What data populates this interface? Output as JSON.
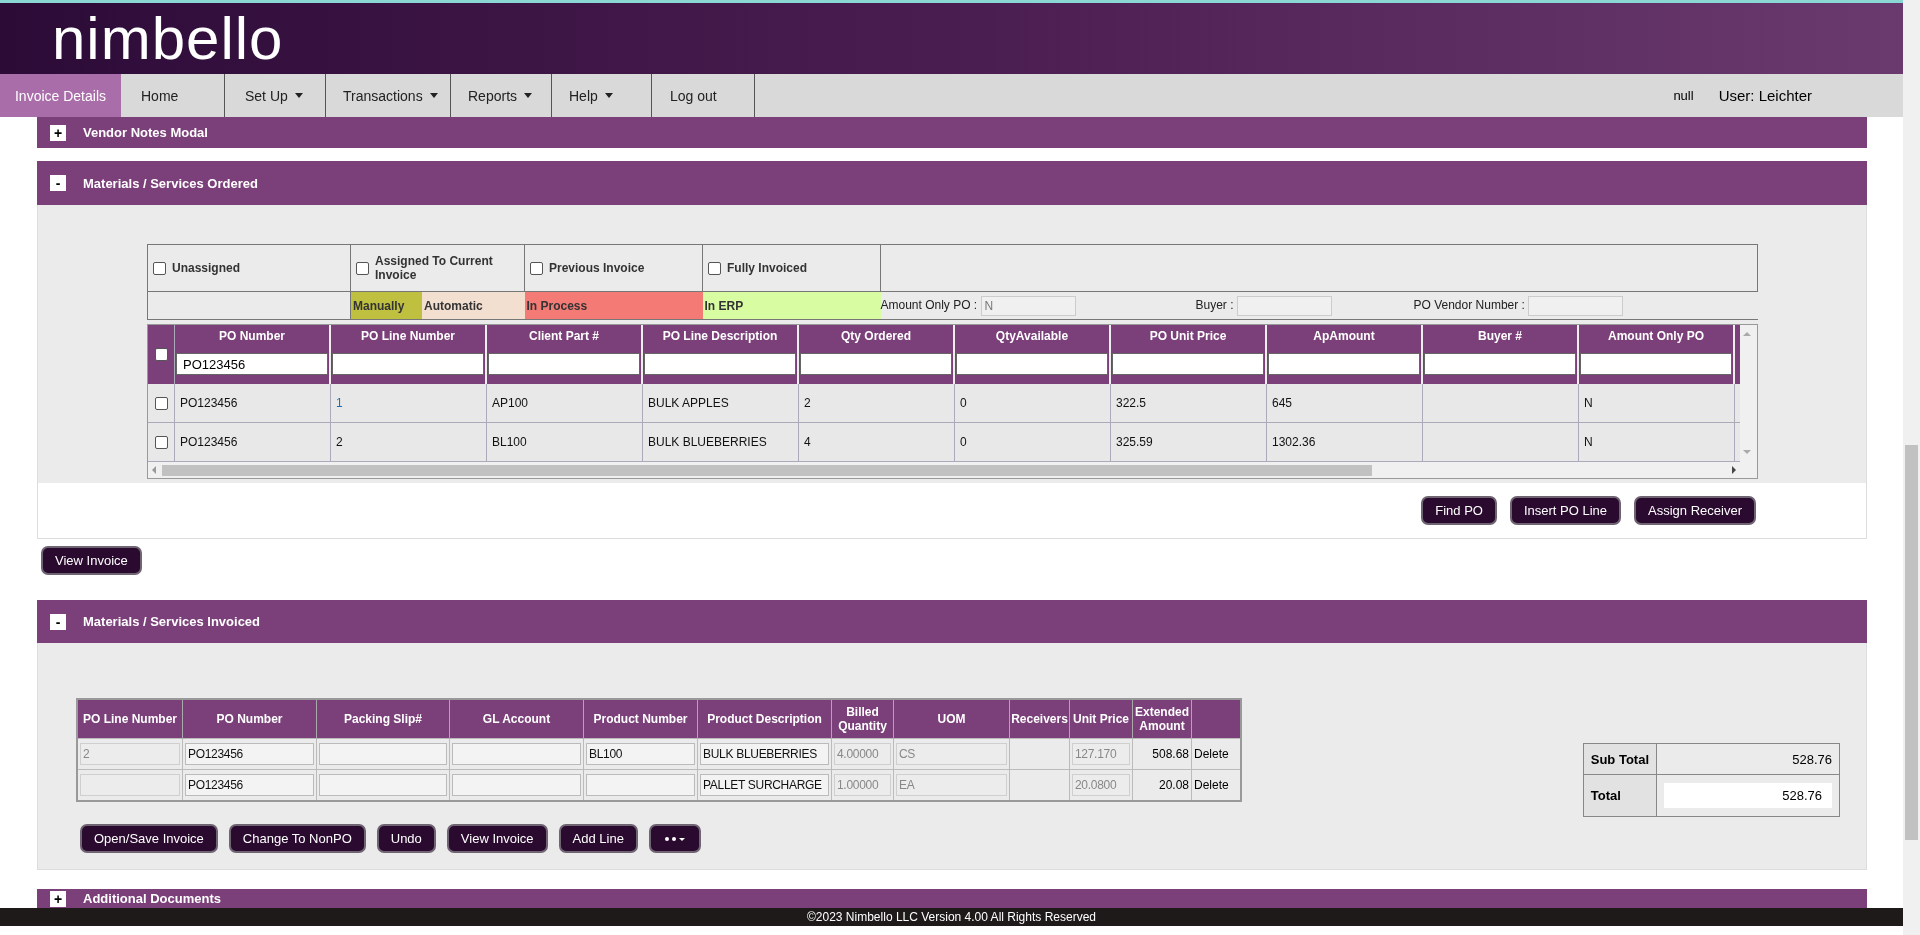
{
  "header": {
    "logo": "nimbello"
  },
  "nav": {
    "items": [
      {
        "label": "Invoice Details",
        "selected": true,
        "dropdown": false
      },
      {
        "label": "Home",
        "selected": false,
        "dropdown": false
      },
      {
        "label": "Set Up",
        "selected": false,
        "dropdown": true
      },
      {
        "label": "Transactions",
        "selected": false,
        "dropdown": true
      },
      {
        "label": "Reports",
        "selected": false,
        "dropdown": true
      },
      {
        "label": "Help",
        "selected": false,
        "dropdown": true
      },
      {
        "label": "Log out",
        "selected": false,
        "dropdown": false
      }
    ],
    "status": "null",
    "user": "User: Leichter"
  },
  "vendor_notes": {
    "toggle": "+",
    "title": "Vendor Notes Modal"
  },
  "materials_ordered": {
    "toggle": "-",
    "title": "Materials / Services Ordered",
    "filters": [
      {
        "label": "Unassigned",
        "checked": false
      },
      {
        "label": "Assigned To Current Invoice",
        "checked": false
      },
      {
        "label": "Previous Invoice",
        "checked": false
      },
      {
        "label": "Fully Invoiced",
        "checked": false
      }
    ],
    "legend": [
      {
        "label": "Manually",
        "color": "#bfbf40"
      },
      {
        "label": "Automatic",
        "color": "#f3dfd0"
      },
      {
        "label": "In Process",
        "color": "#f47a76"
      },
      {
        "label": "In ERP",
        "color": "#d7fca2"
      }
    ],
    "fields": [
      {
        "label": "Amount Only PO :",
        "value": "N"
      },
      {
        "label": "Buyer :"
      },
      {
        "label": "PO Vendor Number :"
      }
    ],
    "grid": {
      "select_all": false,
      "columns": [
        {
          "label": "PO Number",
          "filter": "PO123456"
        },
        {
          "label": "PO Line Number"
        },
        {
          "label": "Client Part #"
        },
        {
          "label": "PO Line Description"
        },
        {
          "label": "Qty Ordered"
        },
        {
          "label": "QtyAvailable"
        },
        {
          "label": "PO Unit Price"
        },
        {
          "label": "ApAmount"
        },
        {
          "label": "Buyer #"
        },
        {
          "label": "Amount Only PO"
        }
      ],
      "rows": [
        {
          "selected": false,
          "line_link": true,
          "cells": [
            "PO123456",
            "1",
            "AP100",
            "BULK APPLES",
            "2",
            "0",
            "322.5",
            "645",
            null,
            "N"
          ]
        },
        {
          "selected": false,
          "line_link": false,
          "cells": [
            "PO123456",
            "2",
            "BL100",
            "BULK BLUEBERRIES",
            "4",
            "0",
            "325.59",
            "1302.36",
            null,
            "N"
          ]
        }
      ]
    },
    "buttons": [
      "Find PO",
      "Insert PO Line",
      "Assign Receiver"
    ]
  },
  "view_invoice": "View Invoice",
  "materials_invoiced": {
    "toggle": "-",
    "title": "Materials / Services Invoiced",
    "columns": [
      "PO Line Number",
      "PO Number",
      "Packing Slip#",
      "GL Account",
      "Product Number",
      "Product Description",
      "Billed Quantity",
      "UOM",
      "Receivers",
      "Unit Price",
      "Extended Amount"
    ],
    "rows": [
      {
        "cells": [
          {
            "kind": "input",
            "value": "2",
            "disabled": true
          },
          {
            "kind": "input",
            "value": "PO123456",
            "disabled": false
          },
          {
            "kind": "input",
            "disabled": false
          },
          {
            "kind": "input",
            "disabled": false
          },
          {
            "kind": "input",
            "value": "BL100",
            "disabled": false
          },
          {
            "kind": "input",
            "value": "BULK BLUEBERRIES",
            "disabled": false
          },
          {
            "kind": "input",
            "value": "4.00000",
            "disabled": true
          },
          {
            "kind": "input",
            "value": "CS",
            "disabled": true
          },
          {
            "kind": "empty"
          },
          {
            "kind": "input",
            "value": "127.170",
            "disabled": true
          },
          {
            "kind": "amount",
            "value": "508.68"
          },
          {
            "kind": "action",
            "value": "Delete"
          }
        ]
      },
      {
        "cells": [
          {
            "kind": "input",
            "disabled": true
          },
          {
            "kind": "input",
            "value": "PO123456",
            "disabled": false
          },
          {
            "kind": "input",
            "disabled": false
          },
          {
            "kind": "input",
            "disabled": false
          },
          {
            "kind": "input",
            "disabled": false
          },
          {
            "kind": "input",
            "value": "PALLET SURCHARGE",
            "disabled": false
          },
          {
            "kind": "input",
            "value": "1.00000",
            "disabled": true
          },
          {
            "kind": "input",
            "value": "EA",
            "disabled": true
          },
          {
            "kind": "empty"
          },
          {
            "kind": "input",
            "value": "20.0800",
            "disabled": true
          },
          {
            "kind": "amount",
            "value": "20.08"
          },
          {
            "kind": "action",
            "value": "Delete"
          }
        ]
      }
    ],
    "buttons": [
      {
        "kind": "text",
        "label": "Open/Save Invoice"
      },
      {
        "kind": "text",
        "label": "Change To NonPO"
      },
      {
        "kind": "text",
        "label": "Undo"
      },
      {
        "kind": "text",
        "label": "View Invoice"
      },
      {
        "kind": "text",
        "label": "Add Line"
      },
      {
        "kind": "more"
      }
    ],
    "totals": [
      {
        "label": "Sub Total",
        "value": "528.76",
        "kind": "text"
      },
      {
        "label": "Total",
        "value": "528.76",
        "kind": "field"
      }
    ]
  },
  "additional_documents": {
    "toggle": "+",
    "title": "Additional Documents"
  },
  "footer": "©2023 Nimbello LLC Version 4.00 All Rights Reserved"
}
